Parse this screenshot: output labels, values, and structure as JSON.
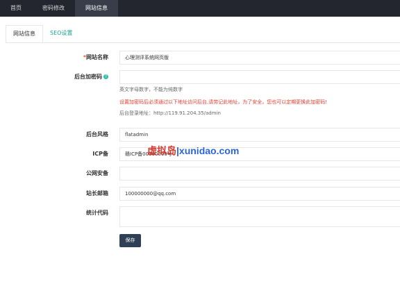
{
  "topnav": {
    "items": [
      {
        "label": "首页"
      },
      {
        "label": "密码修改"
      },
      {
        "label": "网站信息"
      }
    ]
  },
  "tabs": [
    {
      "label": "网站信息"
    },
    {
      "label": "SEO设置"
    }
  ],
  "form": {
    "site_name": {
      "required_mark": "*",
      "label": "网站名称",
      "value": "心理测评系统网页版"
    },
    "admin_code": {
      "label": "后台加密码",
      "help_icon": "question-circle-icon",
      "value": ""
    },
    "tips": {
      "chars": "英文字母数字，不能为纯数字",
      "warning": "设置加密码后必须通过以下地址访问后台,请劳记此地址，为了安全，您也可以定期更换此加密码!",
      "login_url": "后台登录地址：http://119.91.204.35/admin"
    },
    "admin_style": {
      "label": "后台风格",
      "value": "flatadmin"
    },
    "icp": {
      "label": "ICP备",
      "value": "赣ICP备00000000号"
    },
    "police": {
      "label": "公网安备",
      "value": ""
    },
    "email": {
      "label": "站长邮箱",
      "value": "100000000@qq.com"
    },
    "stats_code": {
      "label": "统计代码",
      "value": ""
    }
  },
  "save_button": {
    "label": "保存"
  },
  "watermark": {
    "text": "虚拟岛",
    "separator": "|",
    "domain": "xunidao.com"
  },
  "colors": {
    "topbar": "#23262e",
    "active_nav": "#393d49",
    "accent": "#1aa094",
    "button": "#2f4056",
    "warning": "#e43d2f"
  }
}
